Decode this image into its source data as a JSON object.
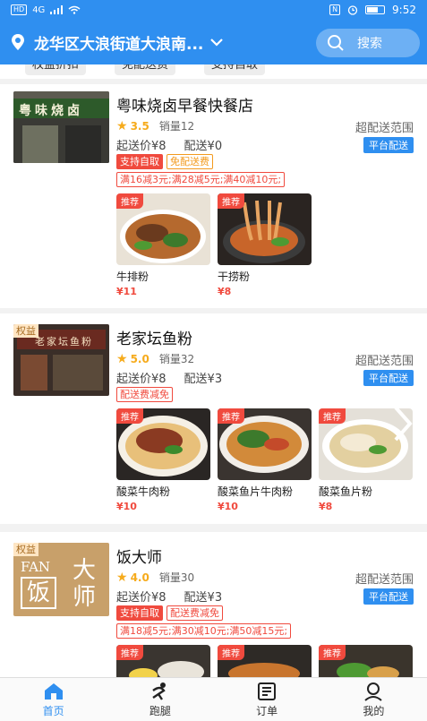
{
  "statusbar": {
    "left_badges": [
      "HD",
      "4G"
    ],
    "time": "9:52"
  },
  "header": {
    "location": "龙华区大浪街道大浪南...",
    "search_label": "搜索"
  },
  "filter_tags": [
    "权益折扣",
    "免配送费",
    "支持自取"
  ],
  "stores": [
    {
      "name": "粤味烧卤早餐快餐店",
      "sign_text": "粤味烧卤",
      "rating": "3.5",
      "sales": "销量12",
      "min_order": "起送价¥8",
      "delivery_fee": "配送¥0",
      "range_label": "超配送范围",
      "delivery_type": "平台配送",
      "tags": [
        "支持自取",
        "免配送费"
      ],
      "promo": "满16减3元;满28减5元;满40减10元;",
      "dishes": [
        {
          "badge": "推荐",
          "name": "牛排粉",
          "price": "¥11"
        },
        {
          "badge": "推荐",
          "name": "干捞粉",
          "price": "¥8"
        }
      ]
    },
    {
      "name": "老家坛鱼粉",
      "badge": "权益",
      "sign_text": "老家坛鱼粉",
      "rating": "5.0",
      "sales": "销量32",
      "min_order": "起送价¥8",
      "delivery_fee": "配送¥3",
      "range_label": "超配送范围",
      "delivery_type": "平台配送",
      "tags": [
        "配送费减免"
      ],
      "dishes": [
        {
          "badge": "推荐",
          "name": "酸菜牛肉粉",
          "price": "¥10"
        },
        {
          "badge": "推荐",
          "name": "酸菜鱼片牛肉粉",
          "price": "¥10"
        },
        {
          "badge": "推荐",
          "name": "酸菜鱼片粉",
          "price": "¥8"
        }
      ]
    },
    {
      "name": "饭大师",
      "badge": "权益",
      "logo_text": [
        "FAN",
        "大",
        "饭",
        "师"
      ],
      "rating": "4.0",
      "sales": "销量30",
      "min_order": "起送价¥8",
      "delivery_fee": "配送¥3",
      "range_label": "超配送范围",
      "delivery_type": "平台配送",
      "tags": [
        "支持自取",
        "配送费减免"
      ],
      "promo": "满18减5元;满30减10元;满50减15元;",
      "dishes": [
        {
          "badge": "推荐"
        },
        {
          "badge": "推荐"
        },
        {
          "badge": "推荐"
        }
      ]
    }
  ],
  "tabbar": [
    {
      "label": "首页",
      "icon": "home-icon",
      "active": true
    },
    {
      "label": "跑腿",
      "icon": "runner-icon",
      "active": false
    },
    {
      "label": "订单",
      "icon": "order-icon",
      "active": false
    },
    {
      "label": "我的",
      "icon": "profile-icon",
      "active": false
    }
  ],
  "colors": {
    "brand": "#2f8ff0",
    "price": "#f04a3e",
    "star": "#f6ab1c"
  }
}
